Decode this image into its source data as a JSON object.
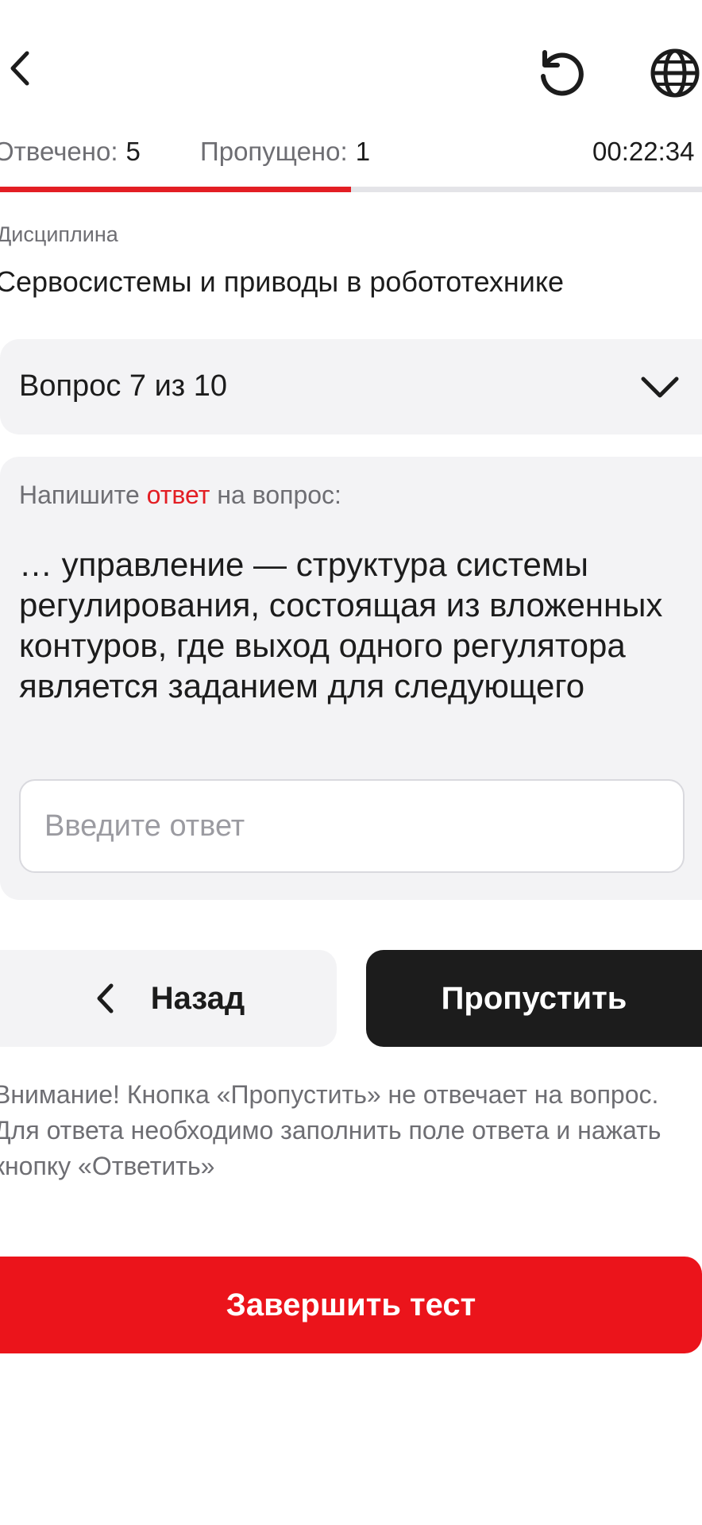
{
  "header": {
    "back_icon": "chevron-left-icon",
    "reload_icon": "reload-icon",
    "language_icon": "globe-icon"
  },
  "stats": {
    "answered_label": "Отвечено:",
    "answered_value": "5",
    "skipped_label": "Пропущено:",
    "skipped_value": "1",
    "timer": "00:22:34"
  },
  "progress": {
    "fraction": 0.5,
    "fill_color": "#e31e24",
    "track_color": "#e4e4e8"
  },
  "discipline": {
    "caption": "Дисциплина",
    "name": "Сервосистемы и приводы в робототехнике"
  },
  "question_selector": {
    "label": "Вопрос 7 из 10",
    "icon": "chevron-down-icon"
  },
  "question": {
    "prompt_before": "Напишите ",
    "prompt_accent": "ответ",
    "prompt_after": " на вопрос:",
    "text": "… управление — структура системы регулирования, состоящая из вложенных контуров, где выход одного регулятора является заданием для следующего",
    "input_value": "",
    "input_placeholder": "Введите ответ"
  },
  "actions": {
    "back_label": "Назад",
    "skip_label": "Пропустить",
    "finish_label": "Завершить тест"
  },
  "notice": "Внимание! Кнопка «Пропустить» не отвечает на вопрос. Для ответа необходимо заполнить поле ответа и нажать кнопку «Ответить»",
  "colors": {
    "accent_red": "#e31e24",
    "finish_red": "#eb141b",
    "dark_button": "#1c1c1c",
    "card_bg": "#f3f3f5"
  }
}
